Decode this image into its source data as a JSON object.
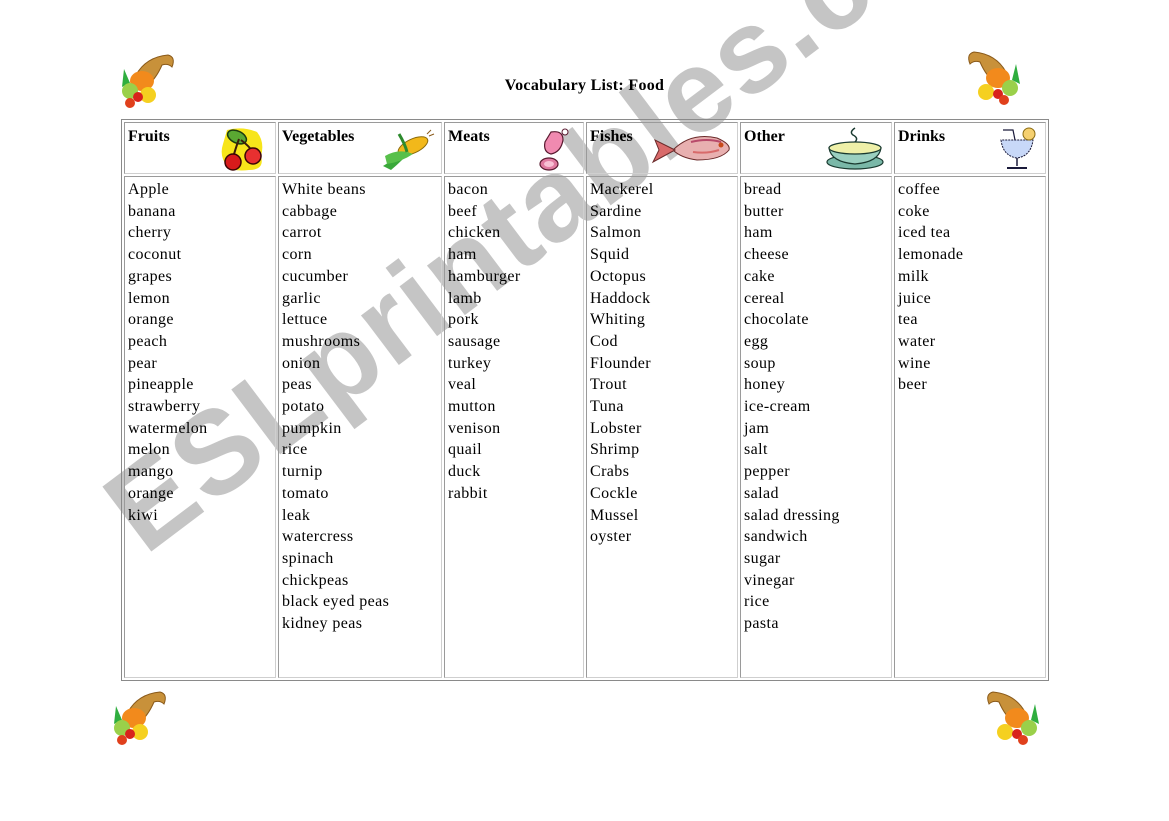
{
  "document": {
    "title": "Vocabulary List: Food",
    "watermark": "ESLprintables.com"
  },
  "decorations": {
    "corner_icon": "cornucopia-icon"
  },
  "columns": [
    {
      "header": "Fruits",
      "icon": "cherries-icon",
      "words": [
        "Apple",
        "banana",
        "cherry",
        "coconut",
        "grapes",
        "lemon",
        "orange",
        "peach",
        "pear",
        "pineapple",
        "strawberry",
        "watermelon",
        "melon",
        "mango",
        "orange",
        "kiwi"
      ]
    },
    {
      "header": "Vegetables",
      "icon": "corn-icon",
      "words": [
        "White beans",
        "cabbage",
        "carrot",
        "corn",
        "cucumber",
        "garlic",
        "lettuce",
        "mushrooms",
        "onion",
        "peas",
        "potato",
        "pumpkin",
        "rice",
        "turnip",
        "tomato",
        "leak",
        "watercress",
        "spinach",
        "chickpeas",
        "black eyed peas",
        "kidney peas"
      ]
    },
    {
      "header": "Meats",
      "icon": "ham-icon",
      "words": [
        "bacon",
        "beef",
        "chicken",
        "ham",
        "hamburger",
        "lamb",
        "pork",
        "sausage",
        "turkey",
        "veal",
        "mutton",
        "venison",
        "quail",
        "duck",
        "rabbit"
      ]
    },
    {
      "header": "Fishes",
      "icon": "fish-icon",
      "words": [
        "Mackerel",
        "Sardine",
        "Salmon",
        "Squid",
        "Octopus",
        "Haddock",
        "Whiting",
        "Cod",
        "Flounder",
        "Trout",
        "Tuna",
        "Lobster",
        "Shrimp",
        "Crabs",
        "Cockle",
        "Mussel",
        "oyster"
      ]
    },
    {
      "header": "Other",
      "icon": "soup-bowl-icon",
      "words": [
        "bread",
        "butter",
        "ham",
        "cheese",
        "cake",
        "cereal",
        "chocolate",
        "egg",
        "soup",
        "honey",
        "ice-cream",
        "jam",
        "salt",
        "pepper",
        "salad",
        "salad dressing",
        "sandwich",
        "sugar",
        "vinegar",
        "rice",
        "pasta"
      ]
    },
    {
      "header": "Drinks",
      "icon": "cocktail-glass-icon",
      "words": [
        "coffee",
        "coke",
        "iced tea",
        "lemonade",
        "milk",
        "juice",
        "tea",
        "water",
        "wine",
        "beer"
      ]
    }
  ]
}
